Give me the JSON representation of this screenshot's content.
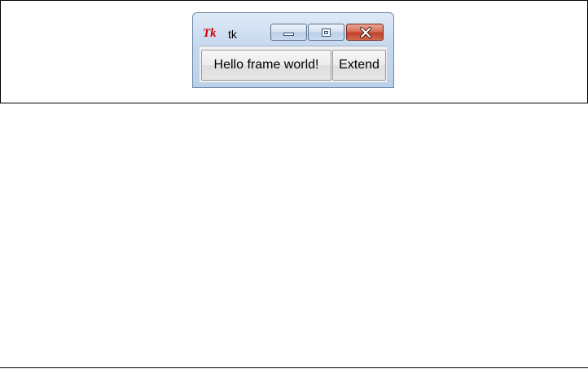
{
  "window": {
    "title": "tk",
    "icon": "tk-feather-icon",
    "controls": {
      "minimize": "minimize-icon",
      "maximize": "maximize-icon",
      "close": "close-icon"
    }
  },
  "buttons": {
    "hello_label": "Hello frame world!",
    "extend_label": "Extend"
  },
  "colors": {
    "close_button": "#c0412c",
    "titlebar": "#c6d8ee",
    "client_background": "#f0f0f0"
  }
}
